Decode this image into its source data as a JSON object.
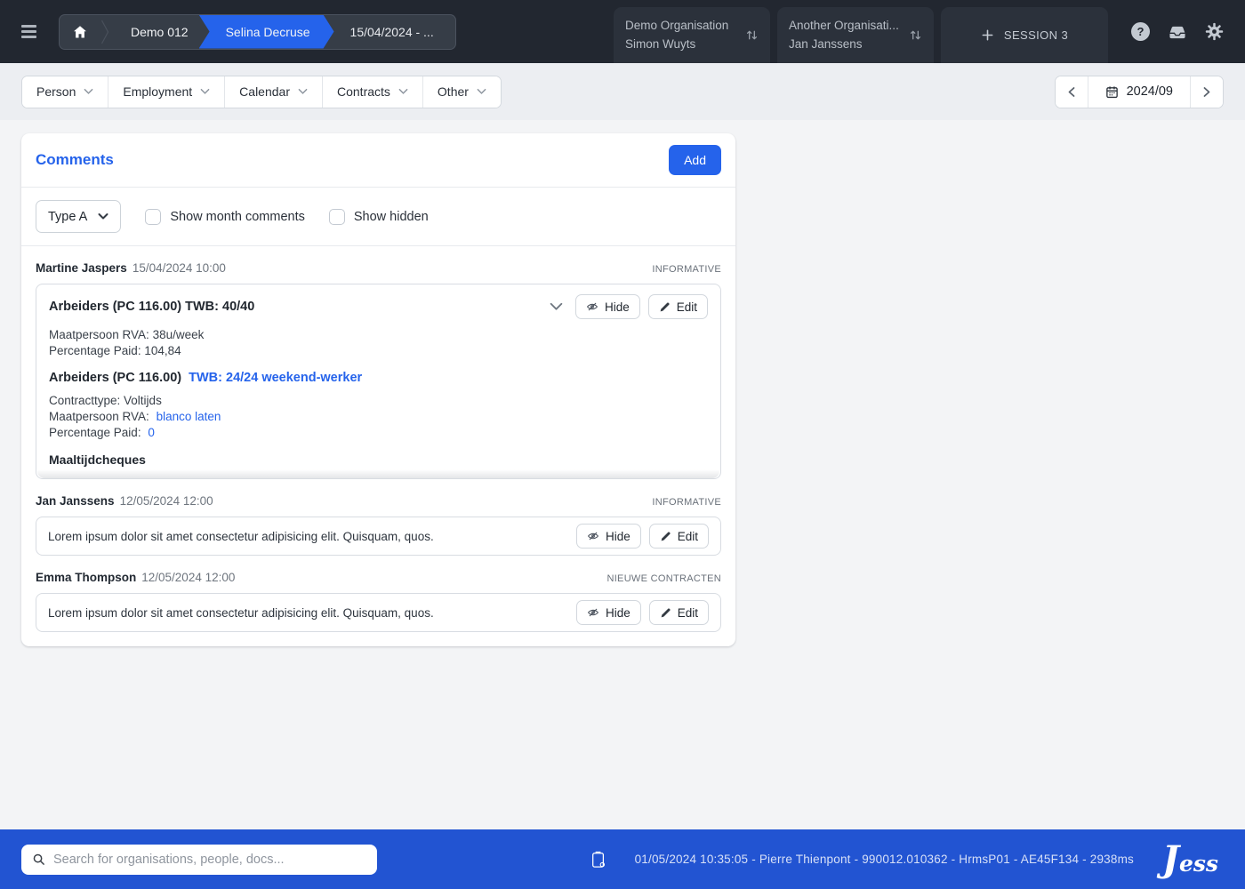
{
  "colors": {
    "accent_blue": "#2563eb",
    "topbar_bg": "#222730",
    "footer_bg": "#2254d2",
    "page_bg": "#f3f4f6"
  },
  "topbar": {
    "breadcrumb": {
      "level1": "Demo 012",
      "active": "Selina Decruse",
      "level3": "15/04/2024 - ..."
    },
    "sessions": [
      {
        "org": "Demo Organisation",
        "person": "Simon Wuyts"
      },
      {
        "org": "Another Organisati...",
        "person": "Jan Janssens"
      }
    ],
    "new_session_label": "SESSION 3"
  },
  "toolbar": {
    "menus": [
      "Person",
      "Employment",
      "Calendar",
      "Contracts",
      "Other"
    ],
    "date_label": "2024/09"
  },
  "comments": {
    "title": "Comments",
    "add_label": "Add",
    "type_filter_value": "Type A",
    "show_month_label": "Show month comments",
    "show_hidden_label": "Show hidden",
    "hide_label": "Hide",
    "edit_label": "Edit",
    "items": [
      {
        "author": "Martine Jaspers",
        "datetime": "15/04/2024 10:00",
        "tag": "INFORMATIVE",
        "block1": {
          "title": "Arbeiders (PC 116.00) TWB: 40/40",
          "line1": "Maatpersoon RVA: 38u/week",
          "line2": "Percentage Paid: 104,84"
        },
        "block2": {
          "title_bold": "Arbeiders (PC 116.00)",
          "title_link": "TWB: 24/24 weekend-werker",
          "line1": "Contracttype: Voltijds",
          "line2_label": "Maatpersoon RVA:",
          "line2_link": "blanco laten",
          "line3_label": "Percentage Paid:",
          "line3_link": "0",
          "footer": "Maaltijdcheques"
        }
      },
      {
        "author": "Jan Janssens",
        "datetime": "12/05/2024 12:00",
        "tag": "INFORMATIVE",
        "text": "Lorem ipsum dolor sit amet consectetur adipisicing elit. Quisquam, quos."
      },
      {
        "author": "Emma Thompson",
        "datetime": "12/05/2024 12:00",
        "tag": "NIEUWE CONTRACTEN",
        "text": "Lorem ipsum dolor sit amet consectetur adipisicing elit. Quisquam, quos."
      }
    ]
  },
  "footer": {
    "search_placeholder": "Search for organisations, people, docs...",
    "status": "01/05/2024 10:35:05 - Pierre Thienpont - 990012.010362 - HrmsP01 - AE45F134 - 2938ms",
    "logo_text": "Jess"
  }
}
